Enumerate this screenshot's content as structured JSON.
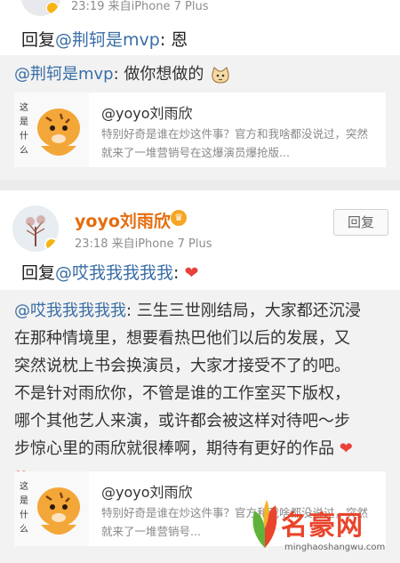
{
  "post1": {
    "meta": "23:19  来自iPhone 7 Plus",
    "reply_prefix": "回复",
    "reply_mention": "@荆轲是mvp",
    "reply_text": ": 恩",
    "quote_mention": "@荆轲是mvp",
    "quote_text": ": 做你想做的",
    "card": {
      "title": "@yoyo刘雨欣",
      "desc": "特别好奇是谁在炒这件事？官方和我啥都没说过，突然就来了一堆营销号在这爆演员爆抢版..."
    }
  },
  "post2": {
    "username": "yoyo刘雨欣",
    "meta": "23:18  来自iPhone 7 Plus",
    "reply_button": "回复",
    "reply_prefix": "回复",
    "reply_mention": "@哎我我我我我",
    "reply_text": ":",
    "quote_mention": "@哎我我我我我",
    "quote_lines": [
      ": 三生三世刚结局，大家都还沉浸",
      "在那种情境里，想要看热巴他们以后的发展，又",
      "突然说枕上书会换演员，大家才接受不了的吧。",
      "不是针对雨欣你，不管是谁的工作室买下版权，",
      "哪个其他艺人来演，或许都会被这样对待吧～步",
      "步惊心里的雨欣就很棒啊，期待有更好的作品"
    ],
    "card": {
      "title": "@yoyo刘雨欣",
      "desc": "特别好奇是谁在炒这件事？官方和我啥都没说过，突然就来了一堆营销号..."
    }
  },
  "thumb_text": "这是什么鬼",
  "watermark": {
    "title": "名豪网",
    "url": "minghaoshangwu.com"
  },
  "colors": {
    "link": "#3a6ea5",
    "username": "#e56c0d",
    "heart": "#e8413b"
  }
}
